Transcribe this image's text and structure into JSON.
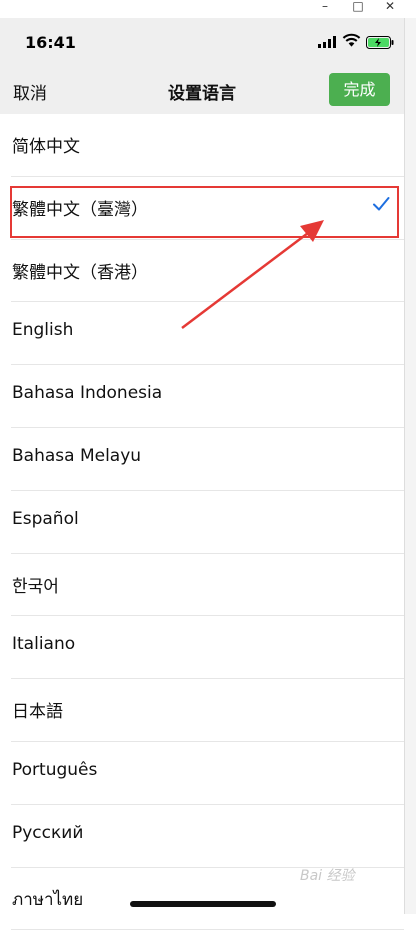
{
  "window": {
    "minimize": "–",
    "maximize": "□",
    "close": "✕"
  },
  "status_bar": {
    "time": "16:41"
  },
  "nav": {
    "cancel": "取消",
    "title": "设置语言",
    "done": "完成"
  },
  "languages": [
    {
      "label": "简体中文",
      "selected": false
    },
    {
      "label": "繁體中文（臺灣）",
      "selected": true
    },
    {
      "label": "繁體中文（香港）",
      "selected": false
    },
    {
      "label": "English",
      "selected": false
    },
    {
      "label": "Bahasa Indonesia",
      "selected": false
    },
    {
      "label": "Bahasa Melayu",
      "selected": false
    },
    {
      "label": "Español",
      "selected": false
    },
    {
      "label": "한국어",
      "selected": false
    },
    {
      "label": "Italiano",
      "selected": false
    },
    {
      "label": "日本語",
      "selected": false
    },
    {
      "label": "Português",
      "selected": false
    },
    {
      "label": "Русский",
      "selected": false
    },
    {
      "label": "ภาษาไทย",
      "selected": false
    }
  ],
  "watermark": "Bai 经验",
  "colors": {
    "accent_green": "#4caf50",
    "check_blue": "#1e6fe0",
    "annotation_red": "#e53935"
  }
}
